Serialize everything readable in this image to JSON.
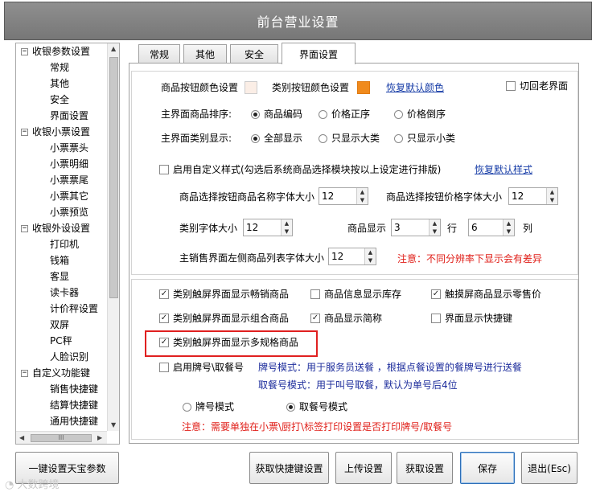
{
  "window": {
    "title": "前台营业设置"
  },
  "tree": {
    "items": [
      {
        "label": "收银参数设置",
        "level": 0,
        "toggle": "⊟"
      },
      {
        "label": "常规",
        "level": 1
      },
      {
        "label": "其他",
        "level": 1
      },
      {
        "label": "安全",
        "level": 1
      },
      {
        "label": "界面设置",
        "level": 1
      },
      {
        "label": "收银小票设置",
        "level": 0,
        "toggle": "⊟"
      },
      {
        "label": "小票票头",
        "level": 1
      },
      {
        "label": "小票明细",
        "level": 1
      },
      {
        "label": "小票票尾",
        "level": 1
      },
      {
        "label": "小票其它",
        "level": 1
      },
      {
        "label": "小票预览",
        "level": 1
      },
      {
        "label": "收银外设设置",
        "level": 0,
        "toggle": "⊟"
      },
      {
        "label": "打印机",
        "level": 1
      },
      {
        "label": "钱箱",
        "level": 1
      },
      {
        "label": "客显",
        "level": 1
      },
      {
        "label": "读卡器",
        "level": 1
      },
      {
        "label": "计价秤设置",
        "level": 1
      },
      {
        "label": "双屏",
        "level": 1
      },
      {
        "label": "PC秤",
        "level": 1
      },
      {
        "label": "人脸识别",
        "level": 1
      },
      {
        "label": "自定义功能键",
        "level": 0,
        "toggle": "⊟"
      },
      {
        "label": "销售快捷键",
        "level": 1
      },
      {
        "label": "结算快捷键",
        "level": 1
      },
      {
        "label": "通用快捷键",
        "level": 1
      }
    ],
    "hscroll_label": "III"
  },
  "tabs": [
    {
      "label": "常规",
      "active": false
    },
    {
      "label": "其他",
      "active": false
    },
    {
      "label": "安全",
      "active": false
    },
    {
      "label": "界面设置",
      "active": true
    }
  ],
  "colors": {
    "product_button_color": "#fbeee6",
    "category_button_color": "#f08a1c",
    "accent_red": "#e02020",
    "link_blue": "#1a3fa8"
  },
  "appearance": {
    "product_button_color_label": "商品按钮颜色设置",
    "category_button_color_label": "类别按钮颜色设置",
    "restore_color_link": "恢复默认颜色",
    "old_ui_label": "切回老界面",
    "old_ui_checked": false,
    "sort_label": "主界面商品排序:",
    "sort_options": [
      "商品编码",
      "价格正序",
      "价格倒序"
    ],
    "sort_selected": 0,
    "category_display_label": "主界面类别显示:",
    "category_options": [
      "全部显示",
      "只显示大类",
      "只显示小类"
    ],
    "category_selected": 0,
    "custom_style_label": "启用自定义样式(勾选后系统商品选择模块按以上设定进行排版)",
    "custom_style_checked": false,
    "restore_style_link": "恢复默认样式",
    "name_font_label": "商品选择按钮商品名称字体大小",
    "name_font_value": "12",
    "price_font_label": "商品选择按钮价格字体大小",
    "price_font_value": "12",
    "category_font_label": "类别字体大小",
    "category_font_value": "12",
    "grid_label": "商品显示",
    "grid_rows_value": "3",
    "grid_rows_unit": "行",
    "grid_cols_value": "6",
    "grid_cols_unit": "列",
    "list_font_label": "主销售界面左侧商品列表字体大小",
    "list_font_value": "12",
    "resolution_note": "注意：不同分辨率下显示会有差异"
  },
  "options": {
    "checkboxes": [
      {
        "label": "类别触屏界面显示畅销商品",
        "checked": true
      },
      {
        "label": "商品信息显示库存",
        "checked": false
      },
      {
        "label": "触摸屏商品显示零售价",
        "checked": true
      },
      {
        "label": "类别触屏界面显示组合商品",
        "checked": true
      },
      {
        "label": "商品显示简称",
        "checked": true
      },
      {
        "label": "界面显示快捷键",
        "checked": false
      },
      {
        "label": "类别触屏界面显示多规格商品",
        "checked": true
      },
      {
        "label": "启用牌号\\取餐号",
        "checked": false
      }
    ],
    "plate_mode_desc": "牌号模式：用于服务员送餐 ，根据点餐设置的餐牌号进行送餐",
    "pickup_mode_desc": "取餐号模式：用于叫号取餐，默认为单号后4位",
    "mode_options": [
      "牌号模式",
      "取餐号模式"
    ],
    "mode_selected": 1,
    "print_note": "注意：需要单独在小票\\厨打\\标签打印设置是否打印牌号/取餐号"
  },
  "buttons": {
    "one_key": "一键设置天宝参数",
    "get_shortcut": "获取快捷键设置",
    "upload": "上传设置",
    "fetch": "获取设置",
    "save": "保存",
    "exit": "退出(Esc)"
  },
  "watermark": "大数跨境"
}
